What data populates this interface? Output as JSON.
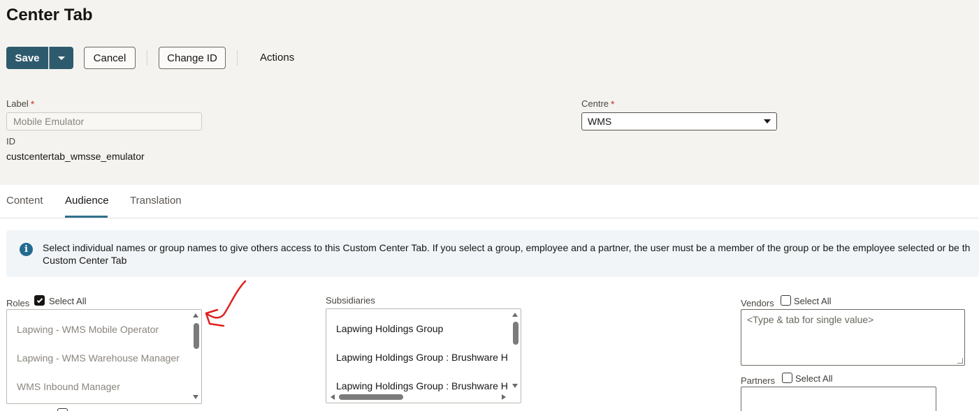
{
  "page": {
    "title": "Center Tab"
  },
  "toolbar": {
    "save_label": "Save",
    "cancel_label": "Cancel",
    "change_id_label": "Change ID",
    "actions_label": "Actions"
  },
  "form": {
    "label": {
      "title": "Label",
      "required_mark": "*",
      "placeholder": "Mobile Emulator"
    },
    "id": {
      "title": "ID",
      "value": "custcentertab_wmsse_emulator"
    },
    "centre": {
      "title": "Centre",
      "required_mark": "*",
      "value": "WMS"
    }
  },
  "tabs": [
    {
      "label": "Content",
      "active": false
    },
    {
      "label": "Audience",
      "active": true
    },
    {
      "label": "Translation",
      "active": false
    }
  ],
  "info": {
    "icon": "info-icon",
    "line1": "Select individual names or group names to give others access to this Custom Center Tab. If you select a group, employee and a partner, the user must be a member of the group or be the employee selected or be th",
    "line2": "Custom Center Tab"
  },
  "roles": {
    "title": "Roles",
    "select_all_label": "Select All",
    "select_all_checked": true,
    "items": [
      "Lapwing - WMS Mobile Operator",
      "Lapwing - WMS Warehouse Manager",
      "WMS Inbound Manager"
    ]
  },
  "subsidiaries": {
    "title": "Subsidiaries",
    "items": [
      "Lapwing Holdings Group",
      "Lapwing Holdings Group : Brushware H",
      "Lapwing Holdings Group : Brushware H"
    ]
  },
  "vendors": {
    "title": "Vendors",
    "select_all_label": "Select All",
    "select_all_checked": false,
    "placeholder": "<Type & tab for single value>"
  },
  "partners": {
    "title": "Partners",
    "select_all_label": "Select All",
    "select_all_checked": false
  },
  "colors": {
    "primary_button": "#2e5a6e",
    "tab_underline": "#2e6f8e",
    "info_icon": "#236a8f",
    "required": "#c0392b",
    "annotation_arrow": "#e0201d"
  }
}
